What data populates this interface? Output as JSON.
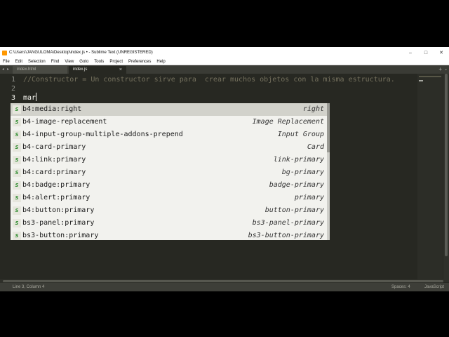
{
  "window": {
    "title": "C:\\Users\\JANGULOMA\\Desktop\\index.js • - Sublime Text (UNREGISTERED)",
    "minimize_glyph": "–",
    "maximize_glyph": "□",
    "close_glyph": "✕"
  },
  "menu": [
    "File",
    "Edit",
    "Selection",
    "Find",
    "View",
    "Goto",
    "Tools",
    "Project",
    "Preferences",
    "Help"
  ],
  "tabs": {
    "nav_left": "◂",
    "nav_right": "▸",
    "items": [
      {
        "label": "index.html",
        "active": false
      },
      {
        "label": "index.js",
        "active": true,
        "close": "×"
      }
    ],
    "add": "+",
    "overflow": "⌄"
  },
  "editor": {
    "line_numbers": [
      "1",
      "2",
      "3"
    ],
    "lines": [
      "//Constructor = Un constructor sirve para  crear muchos objetos con la misma estructura.",
      "",
      "mar"
    ],
    "colors": {
      "background": "#272822",
      "comment": "#75715e",
      "text": "#f8f8f2"
    }
  },
  "autocomplete": {
    "kind_label": "s",
    "items": [
      {
        "trigger": "b4:media:right",
        "hint": "right",
        "selected": true
      },
      {
        "trigger": "b4-image-replacement",
        "hint": "Image Replacement",
        "selected": false
      },
      {
        "trigger": "b4-input-group-multiple-addons-prepend",
        "hint": "Input Group",
        "selected": false
      },
      {
        "trigger": "b4-card-primary",
        "hint": "Card",
        "selected": false
      },
      {
        "trigger": "b4:link:primary",
        "hint": "link-primary",
        "selected": false
      },
      {
        "trigger": "b4:card:primary",
        "hint": "bg-primary",
        "selected": false
      },
      {
        "trigger": "b4:badge:primary",
        "hint": "badge-primary",
        "selected": false
      },
      {
        "trigger": "b4:alert:primary",
        "hint": "primary",
        "selected": false
      },
      {
        "trigger": "b4:button:primary",
        "hint": "button-primary",
        "selected": false
      },
      {
        "trigger": "bs3-panel:primary",
        "hint": "bs3-panel-primary",
        "selected": false
      },
      {
        "trigger": "bs3-button:primary",
        "hint": "bs3-button-primary",
        "selected": false
      }
    ]
  },
  "status": {
    "position": "Line 3, Column 4",
    "spaces": "Spaces: 4",
    "syntax": "JavaScript"
  }
}
